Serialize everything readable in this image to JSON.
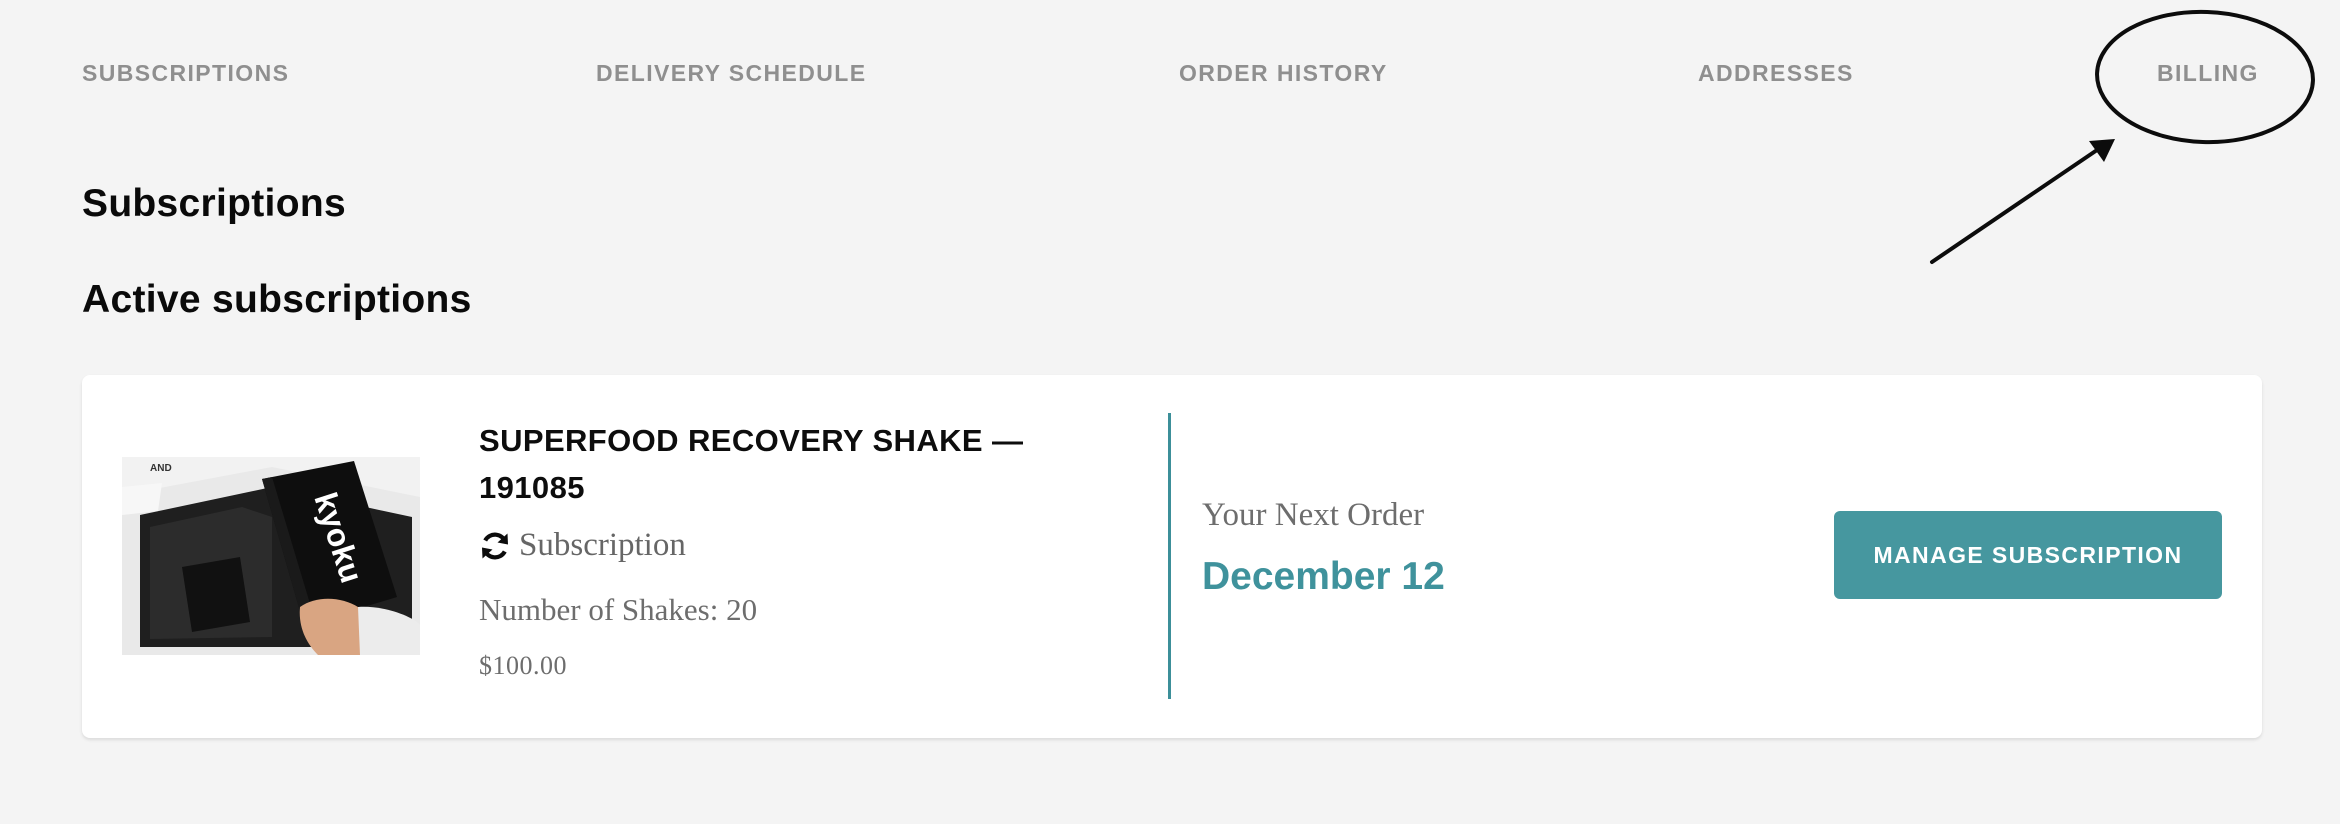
{
  "nav": {
    "items": [
      {
        "label": "SUBSCRIPTIONS"
      },
      {
        "label": "DELIVERY SCHEDULE"
      },
      {
        "label": "ORDER HISTORY"
      },
      {
        "label": "ADDRESSES"
      },
      {
        "label": "BILLING"
      }
    ]
  },
  "page": {
    "title": "Subscriptions",
    "section_title": "Active subscriptions"
  },
  "subscription": {
    "product_name": "SUPERFOOD RECOVERY SHAKE — 191085",
    "type_icon": "refresh-icon",
    "type_label": "Subscription",
    "quantity": "Number of Shakes: 20",
    "price": "$100.00",
    "next_order_label": "Your Next Order",
    "next_order_date": "December 12",
    "manage_button": "MANAGE SUBSCRIPTION",
    "product_image_text": "kyoku"
  },
  "colors": {
    "accent": "#46979f",
    "accent_text": "#3f929c",
    "background": "#f4f4f4",
    "nav_text": "#8f8f8f"
  }
}
